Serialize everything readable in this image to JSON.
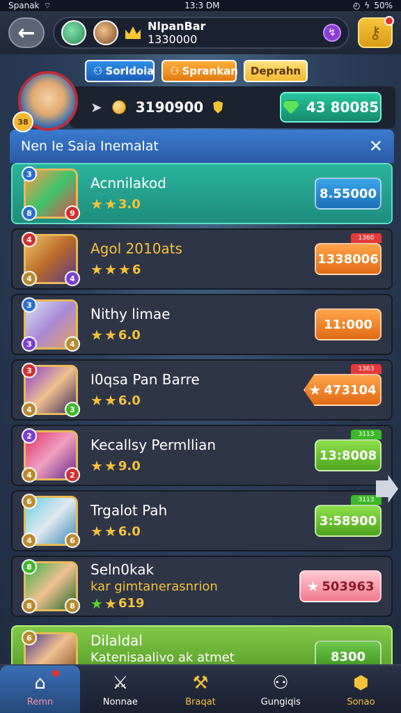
{
  "status_bar": {
    "carrier": "Spanak",
    "time": "13:3 DM",
    "battery": "50%"
  },
  "top_bar": {
    "player_name": "NlpanBar",
    "player_score": "1330000"
  },
  "tabs": [
    {
      "label": "Sorldoia"
    },
    {
      "label": "Sprankan"
    },
    {
      "label": "Deprahn"
    }
  ],
  "profile": {
    "level": "38",
    "coins": "3190900",
    "gems": "43 80085"
  },
  "list": {
    "header": "Nen Ie Saia Inemalat",
    "rows": [
      {
        "title": "Acnnilakod",
        "subtitle": "",
        "rating": "3.0",
        "price": "8.55000",
        "badges": [
          "3",
          "8",
          "9"
        ],
        "tag": ""
      },
      {
        "title": "Agol 2010ats",
        "subtitle": "",
        "rating": "6",
        "price": "1338006",
        "badges": [
          "4",
          "4",
          "4"
        ],
        "tag": "1360"
      },
      {
        "title": "Nithy limae",
        "subtitle": "",
        "rating": "6.0",
        "price": "11:000",
        "badges": [
          "3",
          "3",
          "4"
        ],
        "tag": ""
      },
      {
        "title": "I0qsa Pan Barre",
        "subtitle": "",
        "rating": "6.0",
        "price": "473104",
        "badges": [
          "3",
          "4",
          "3"
        ],
        "tag": "1363"
      },
      {
        "title": "Kecallsy Permllian",
        "subtitle": "",
        "rating": "9.0",
        "price": "13:8008",
        "badges": [
          "2",
          "4",
          "2"
        ],
        "tag": "3113"
      },
      {
        "title": "Trgalot Pah",
        "subtitle": "",
        "rating": "6.0",
        "price": "3:58900",
        "badges": [
          "6",
          "4",
          "6"
        ],
        "tag": "3113"
      },
      {
        "title": "Seln0kak",
        "subtitle": "kar gimtanerasnrion",
        "rating": "619",
        "price": "503963",
        "badges": [
          "8",
          "8",
          "8"
        ],
        "tag": ""
      },
      {
        "title": "Dilaldal",
        "subtitle": "Katenisaalivo ak atmet",
        "rating": "",
        "price": "8300",
        "badges": [
          "6",
          "",
          ""
        ],
        "tag": ""
      }
    ]
  },
  "bottom_nav": [
    {
      "label": "Remn"
    },
    {
      "label": "Nonnae"
    },
    {
      "label": "Braqat"
    },
    {
      "label": "Gungiqis"
    },
    {
      "label": "Sonao"
    }
  ]
}
